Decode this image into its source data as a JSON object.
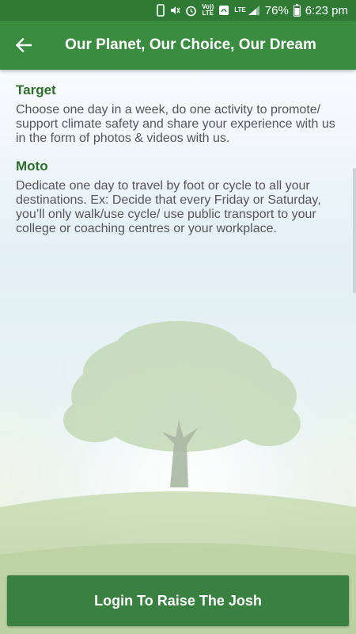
{
  "status_bar": {
    "volte_label": "Vo))\nLTE",
    "lte_label": "LTE",
    "battery_percent": "76%",
    "time": "6:23 pm",
    "icons": [
      "phone-icon",
      "mute-icon",
      "alarm-icon",
      "volte-icon",
      "wifi-calling-icon",
      "lte-signal-icon",
      "battery-icon"
    ]
  },
  "app_bar": {
    "title": "Our Planet, Our Choice, Our Dream",
    "back_icon": "arrow-left-icon"
  },
  "sections": [
    {
      "heading": "Target",
      "body": "Choose one day in a week, do one activity to promote/ support climate safety and share your experience with us in the form of photos & videos with us."
    },
    {
      "heading": "Moto",
      "body": "Dedicate one day to travel by foot or cycle to all your destinations. Ex: Decide that every Friday or Saturday, you’ll only walk/use cycle/ use public transport to your college or coaching centres or your workplace."
    }
  ],
  "login_button": {
    "label": "Login To Raise The Josh"
  },
  "colors": {
    "status_bar": "#2f7a35",
    "app_bar": "#3a8c40",
    "heading": "#2e6e2c",
    "body_text": "#555555",
    "button": "#3a8040"
  }
}
